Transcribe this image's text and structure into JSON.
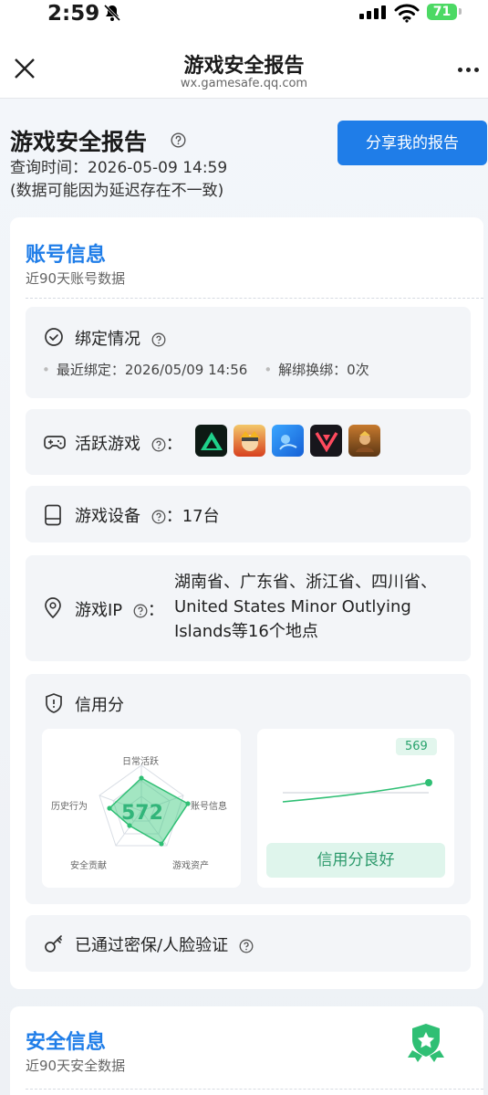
{
  "status_bar": {
    "time": "2:59",
    "battery": "71"
  },
  "nav": {
    "title": "游戏安全报告",
    "url": "wx.gamesafe.qq.com"
  },
  "header": {
    "title": "游戏安全报告",
    "query_time": "查询时间：2026-05-09 14:59",
    "note": "(数据可能因为延迟存在不一致)",
    "share_button": "分享我的报告"
  },
  "account": {
    "title": "账号信息",
    "subtitle": "近90天账号数据",
    "binding": {
      "label": "绑定情况",
      "recent_bind": "最近绑定：2026/05/09 14:56",
      "rebind": "解绑换绑：0次"
    },
    "active_games": {
      "label": "活跃游戏",
      "colon": "：",
      "icons": [
        "triangle-game-icon",
        "ninja-game-icon",
        "blue-game-icon",
        "valorant-game-icon",
        "hero-game-icon"
      ]
    },
    "devices": {
      "label": "游戏设备",
      "value": "：17台"
    },
    "ip": {
      "label": "游戏IP",
      "colon": "：",
      "value": "湖南省、广东省、浙江省、四川省、United States Minor Outlying Islands等16个地点"
    },
    "credit": {
      "label": "信用分",
      "score": "572",
      "radar_labels": [
        "日常活跃",
        "账号信息",
        "游戏资产",
        "安全贡献",
        "历史行为"
      ],
      "trend_value": "569",
      "status": "信用分良好"
    },
    "verified": {
      "label": "已通过密保/人脸验证"
    }
  },
  "security": {
    "title": "安全信息",
    "subtitle": "近90天安全数据"
  },
  "colors": {
    "accent": "#1f7de8",
    "green": "#32b57a"
  }
}
